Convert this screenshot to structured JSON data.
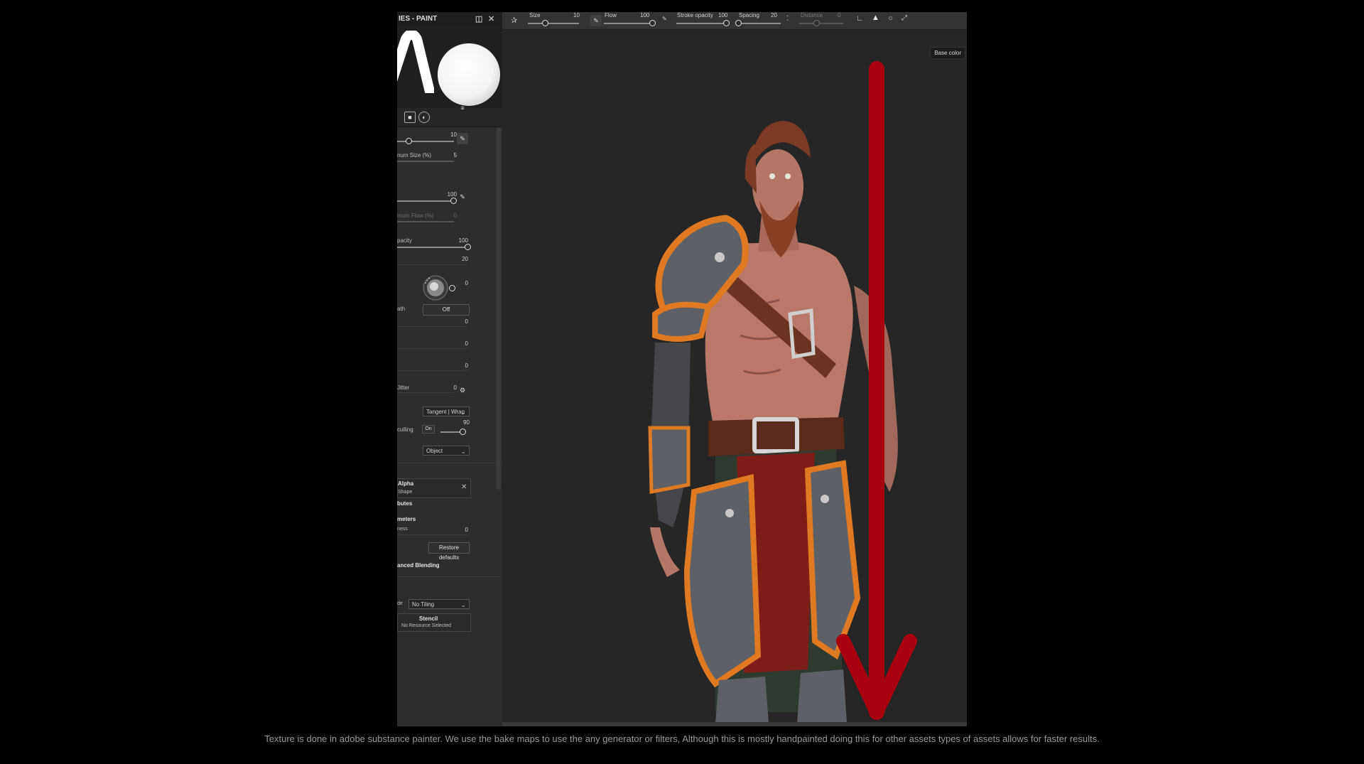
{
  "panel": {
    "title": "IES - PAINT",
    "size_value": "10",
    "min_size_label": "num Size (%)",
    "min_size_value": "5",
    "flow_value": "100",
    "min_flow_label": "mum Flow (%)",
    "min_flow_value": "0",
    "opacity_label": "pacity",
    "opacity_value": "100",
    "spacing_value": "20",
    "angle_value": "0",
    "follow_path_label": "ath",
    "follow_path_value": "Off",
    "jitter1_value": "0",
    "jitter2_value": "0",
    "jitter3_value": "0",
    "jitter4_label": "Jitter",
    "jitter4_value": "0",
    "alignment_value": "Tangent | Wrap",
    "backface_label": "culling",
    "backface_toggle": "On",
    "backface_value": "90",
    "space_value": "Object",
    "alpha_title": "Alpha",
    "alpha_sub": "Shape",
    "attributes_label": "butes",
    "parameters_label": "meters",
    "hardness_label": "ness",
    "hardness_value": "0",
    "restore_defaults": "Restore defaults",
    "advanced_blending": "anced Blending",
    "tiling_label": "de",
    "tiling_value": "No Tiling",
    "stencil_title": "Stencil",
    "stencil_sub": "No Resource Selected"
  },
  "toolbar": {
    "size_label": "Size",
    "size_value": "10",
    "flow_label": "Flow",
    "flow_value": "100",
    "stroke_opacity_label": "Stroke opacity",
    "stroke_opacity_value": "100",
    "spacing_label": "Spacing",
    "spacing_value": "20",
    "distance_label": "Distance",
    "distance_value": "0"
  },
  "viewport": {
    "channel_label": "Base color"
  },
  "caption": "Texture is done in adobe substance painter. We use the bake maps to use the any generator or filters, Although this is mostly handpainted doing this for other assets types of assets allows for faster results.",
  "colors": {
    "annotation_arrow": "#a8000f",
    "armor_orange": "#e07a22",
    "armor_gray": "#5d6066"
  }
}
